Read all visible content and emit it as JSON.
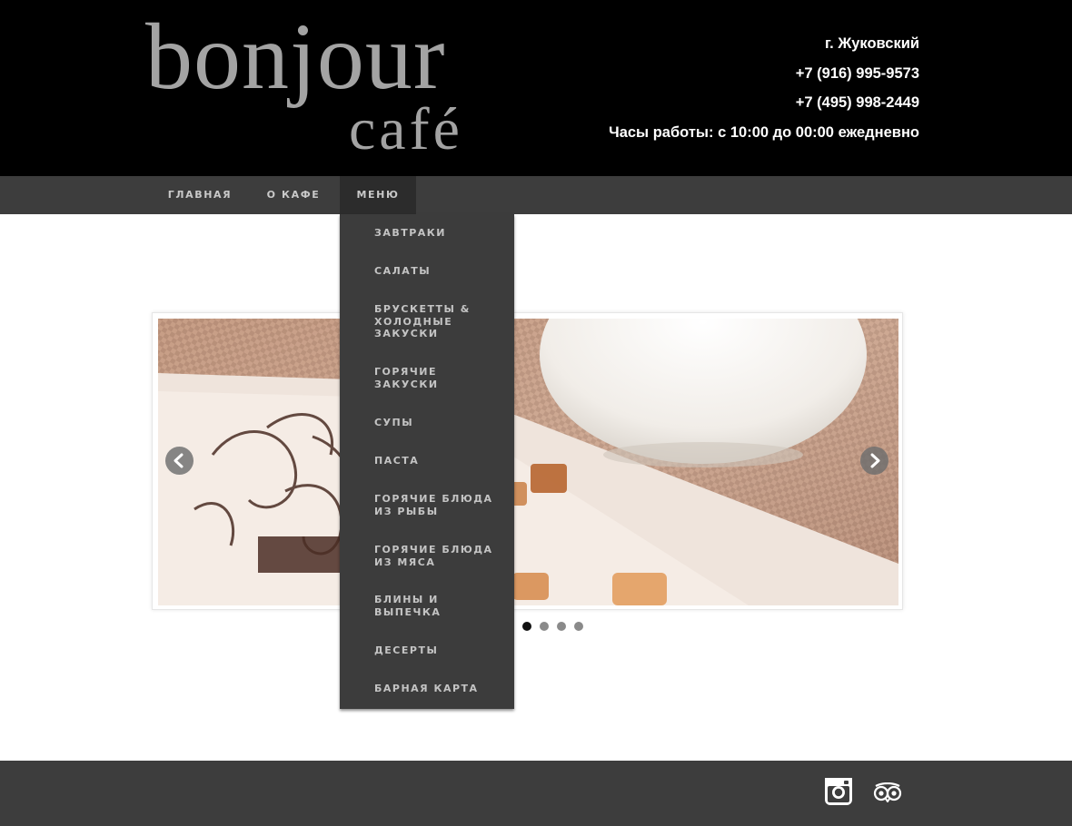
{
  "logo": {
    "line1": "bonjour",
    "line2": "café"
  },
  "contacts": {
    "city": "г. Жуковский",
    "phone1": "+7 (916) 995-9573",
    "phone2": "+7 (495) 998-2449",
    "hours": "Часы работы: с 10:00 до 00:00 ежедневно"
  },
  "nav": {
    "items": [
      {
        "label": "ГЛАВНАЯ"
      },
      {
        "label": "О КАФЕ"
      },
      {
        "label": "МЕНЮ",
        "active": true
      }
    ]
  },
  "menu_dropdown": {
    "items": [
      {
        "label": "ЗАВТРАКИ"
      },
      {
        "label": "САЛАТЫ"
      },
      {
        "label": "БРУСКЕТТЫ & ХОЛОДНЫЕ ЗАКУСКИ"
      },
      {
        "label": "ГОРЯЧИЕ ЗАКУСКИ"
      },
      {
        "label": "СУПЫ"
      },
      {
        "label": "ПАСТА"
      },
      {
        "label": "ГОРЯЧИЕ БЛЮДА ИЗ РЫБЫ"
      },
      {
        "label": "ГОРЯЧИЕ БЛЮДА ИЗ МЯСА"
      },
      {
        "label": "БЛИНЫ И ВЫПЕЧКА"
      },
      {
        "label": "ДЕСЕРТЫ"
      },
      {
        "label": "БАРНАЯ КАРТА"
      }
    ]
  },
  "slider": {
    "slide_count": 4,
    "active_index": 0,
    "prev_icon": "chevron-left-icon",
    "next_icon": "chevron-right-icon"
  },
  "footer": {
    "social": [
      {
        "icon": "instagram-icon"
      },
      {
        "icon": "tripadvisor-icon"
      }
    ]
  },
  "colors": {
    "header_bg": "#000000",
    "nav_bg": "#3d3d3d",
    "nav_active_bg": "#2c2c2c",
    "dropdown_bg": "#3c3c3c",
    "footer_bg": "#3d3d3d",
    "logo_gray": "#a3a3a3"
  }
}
